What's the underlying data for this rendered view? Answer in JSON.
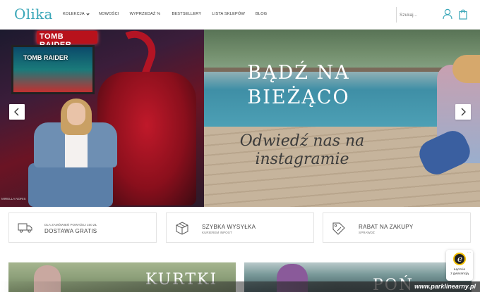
{
  "header": {
    "logo": "Olika",
    "nav": [
      {
        "label": "KOLEKCJA",
        "has_dropdown": true
      },
      {
        "label": "NOWOŚCI",
        "has_dropdown": false
      },
      {
        "label": "WYPRZEDAŻ %",
        "has_dropdown": false
      },
      {
        "label": "BESTSELLERY",
        "has_dropdown": false
      },
      {
        "label": "LISTA SKLEPÓW",
        "has_dropdown": false
      },
      {
        "label": "BLOG",
        "has_dropdown": false
      }
    ],
    "search_placeholder": "Szukaj...",
    "icons": [
      "user-icon",
      "shopping-bag-icon"
    ],
    "accent_color": "#3aa7b8"
  },
  "hero": {
    "title_line1": "BĄDŹ NA",
    "title_line2": "BIEŻĄCO",
    "subtitle_line1": "Odwiedź nas na",
    "subtitle_line2": "instagramie",
    "left_arcade_sign": "TOMB RAIDER",
    "left_arcade_sign_small": "TOMB RAIDER",
    "watermark": "MIRELLA NORIS"
  },
  "info_boxes": [
    {
      "icon": "delivery-truck-icon",
      "small": "DLA ZAMÓWIEŃ POWYŻEJ 150 ZŁ",
      "big": "DOSTAWA GRATIS"
    },
    {
      "icon": "package-box-icon",
      "title": "SZYBKA WYSYŁKA",
      "sub": "KURIEREM INPOST"
    },
    {
      "icon": "discount-tag-icon",
      "title": "RABAT NA ZAKUPY",
      "sub": "SPRAWDŹ"
    }
  ],
  "categories": [
    {
      "label": "KURTKI"
    },
    {
      "label": "POŃ"
    }
  ],
  "trust_badge": {
    "letter": "e",
    "line1": "Łączcie",
    "line2": "z gwarancją"
  },
  "footer_watermark": "www.parklinearny.pl"
}
